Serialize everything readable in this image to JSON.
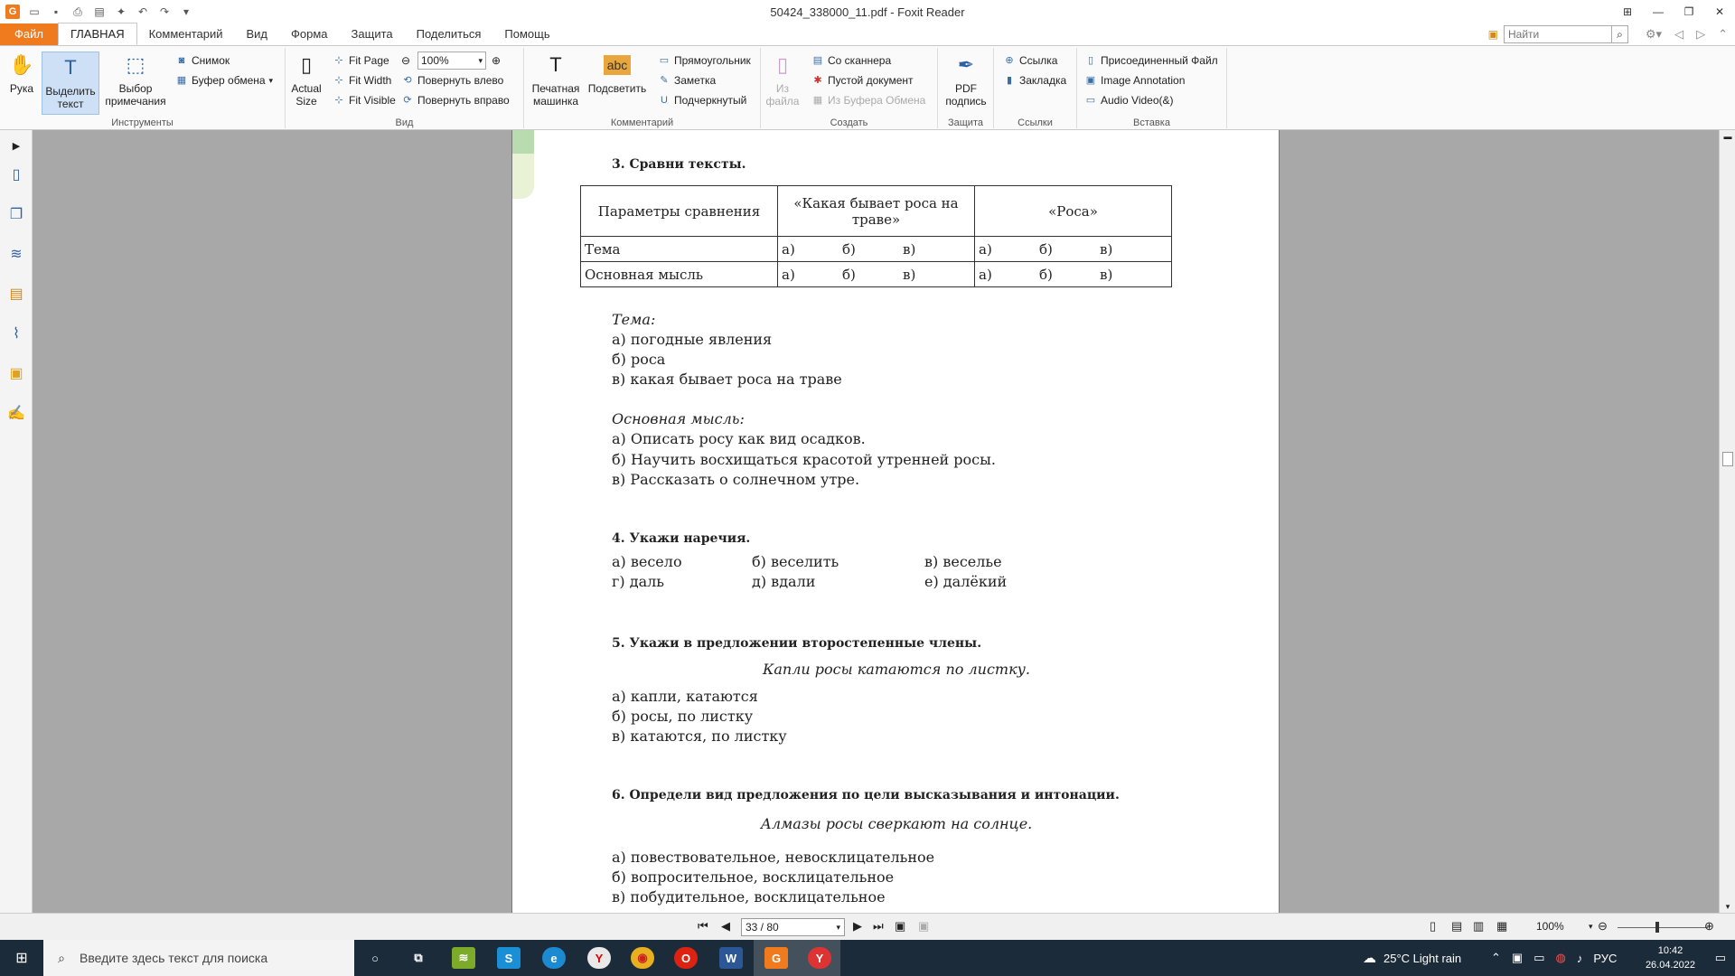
{
  "window": {
    "title": "50424_338000_11.pdf - Foxit Reader",
    "app_logo": "G"
  },
  "menu": {
    "tabs": [
      "Файл",
      "ГЛАВНАЯ",
      "Комментарий",
      "Вид",
      "Форма",
      "Защита",
      "Поделиться",
      "Помощь"
    ],
    "active_tab": "ГЛАВНАЯ",
    "search_placeholder": "Найти"
  },
  "ribbon": {
    "tools": {
      "label": "Инструменты",
      "hand": "Рука",
      "select_text": "Выделить текст",
      "select_annotation": "Выбор примечания",
      "snapshot": "Снимок",
      "clipboard": "Буфер обмена"
    },
    "view": {
      "label": "Вид",
      "actual_size": "Actual Size",
      "fit_page": "Fit Page",
      "fit_width": "Fit Width",
      "fit_visible": "Fit Visible",
      "zoom_value": "100%",
      "rotate_left": "Повернуть влево",
      "rotate_right": "Повернуть вправо"
    },
    "comment": {
      "label": "Комментарий",
      "typewriter": "Печатная машинка",
      "highlight": "Подсветить",
      "highlight_icon_text": "abc",
      "rectangle": "Прямоугольник",
      "note": "Заметка",
      "underline": "Подчеркнутый"
    },
    "create": {
      "label": "Создать",
      "from_file": "Из файла",
      "from_scanner": "Со сканнера",
      "blank_doc": "Пустой документ",
      "from_clipboard": "Из Буфера Обмена"
    },
    "protect": {
      "label": "Защита",
      "pdf_sign": "PDF подпись"
    },
    "links": {
      "label": "Ссылки",
      "link": "Ссылка",
      "bookmark": "Закладка"
    },
    "insert": {
      "label": "Вставка",
      "attached_file": "Присоединенный Файл",
      "image_annotation": "Image Annotation",
      "audio_video": "Audio  Video(&)"
    }
  },
  "document": {
    "task3": {
      "heading": "3. Сравни тексты.",
      "table": {
        "header": [
          "Параметры сравнения",
          "«Какая бывает роса на траве»",
          "«Роса»"
        ],
        "rows": [
          {
            "label": "Тема",
            "opts": [
              "а)",
              "б)",
              "в)"
            ]
          },
          {
            "label": "Основная мысль",
            "opts": [
              "а)",
              "б)",
              "в)"
            ]
          }
        ]
      },
      "theme_title": "Тема:",
      "theme_options": [
        "а) погодные явления",
        "б) роса",
        "в) какая бывает роса на траве"
      ],
      "idea_title": "Основная мысль:",
      "idea_options": [
        "а) Описать росу как вид осадков.",
        "б) Научить восхищаться красотой утренней росы.",
        "в) Рассказать о солнечном утре."
      ]
    },
    "task4": {
      "heading": "4. Укажи наречия.",
      "options": [
        "а) весело",
        "б) веселить",
        "в) веселье",
        "г) даль",
        "д) вдали",
        "е) далёкий"
      ]
    },
    "task5": {
      "heading": "5. Укажи в предложении второстепенные члены.",
      "sentence": "Капли росы катаются по листку.",
      "options": [
        "а) капли, катаются",
        "б) росы, по листку",
        "в) катаются, по листку"
      ]
    },
    "task6": {
      "heading": "6. Определи вид предложения по цели высказывания и интонации.",
      "sentence": "Алмазы росы сверкают на солнце.",
      "options": [
        "а) повествовательное, невосклицательное",
        "б) вопросительное, восклицательное",
        "в) побудительное, восклицательное"
      ]
    }
  },
  "status": {
    "page": "33 / 80",
    "zoom": "100%"
  },
  "taskbar": {
    "search_placeholder": "Введите здесь текст для поиска",
    "weather": "25°C  Light rain",
    "lang": "РУС",
    "time": "10:42",
    "date": "26.04.2022"
  }
}
